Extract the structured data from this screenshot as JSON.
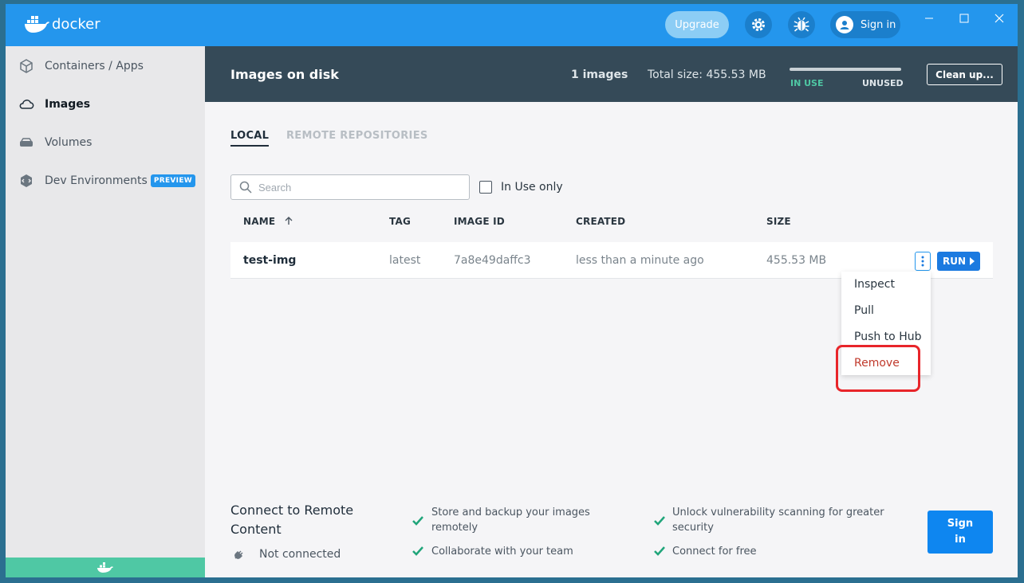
{
  "app": {
    "name": "docker"
  },
  "titlebar": {
    "upgrade_label": "Upgrade",
    "signin_label": "Sign in",
    "icons": [
      "settings-gear-icon",
      "bug-icon",
      "user-icon",
      "minimize-icon",
      "maximize-icon",
      "close-icon"
    ]
  },
  "sidebar": {
    "items": [
      {
        "label": "Containers / Apps",
        "icon": "containers-icon"
      },
      {
        "label": "Images",
        "icon": "cloud-icon"
      },
      {
        "label": "Volumes",
        "icon": "volume-icon"
      },
      {
        "label": "Dev Environments",
        "icon": "dev-env-icon",
        "badge": "PREVIEW"
      }
    ]
  },
  "header": {
    "title": "Images on disk",
    "count": "1 images",
    "total_size": "Total size: 455.53 MB",
    "in_use_label": "IN USE",
    "unused_label": "UNUSED",
    "in_use_fraction": 0.0,
    "cleanup_label": "Clean up..."
  },
  "tabs": [
    "LOCAL",
    "REMOTE REPOSITORIES"
  ],
  "search": {
    "placeholder": "Search",
    "value": ""
  },
  "filter": {
    "label": "In Use only",
    "checked": false
  },
  "table": {
    "columns": [
      "NAME",
      "TAG",
      "IMAGE ID",
      "CREATED",
      "SIZE"
    ],
    "rows": [
      {
        "name": "test-img",
        "tag": "latest",
        "image_id": "7a8e49daffc3",
        "created": "less than a minute ago",
        "size": "455.53 MB"
      }
    ],
    "run_label": "RUN"
  },
  "context_menu": {
    "items": [
      "Inspect",
      "Pull",
      "Push to Hub",
      "Remove"
    ]
  },
  "footer": {
    "title": "Connect to Remote Content",
    "status": "Not connected",
    "features": [
      "Store and backup your images remotely",
      "Unlock vulnerability scanning for greater security",
      "Collaborate with your team",
      "Connect for free"
    ],
    "signin_label": "Sign in"
  },
  "colors": {
    "brand": "#2496ed",
    "band": "#354a58",
    "accent_green": "#4fc8a4",
    "danger": "#c0392b",
    "annotation": "#e8252a"
  }
}
